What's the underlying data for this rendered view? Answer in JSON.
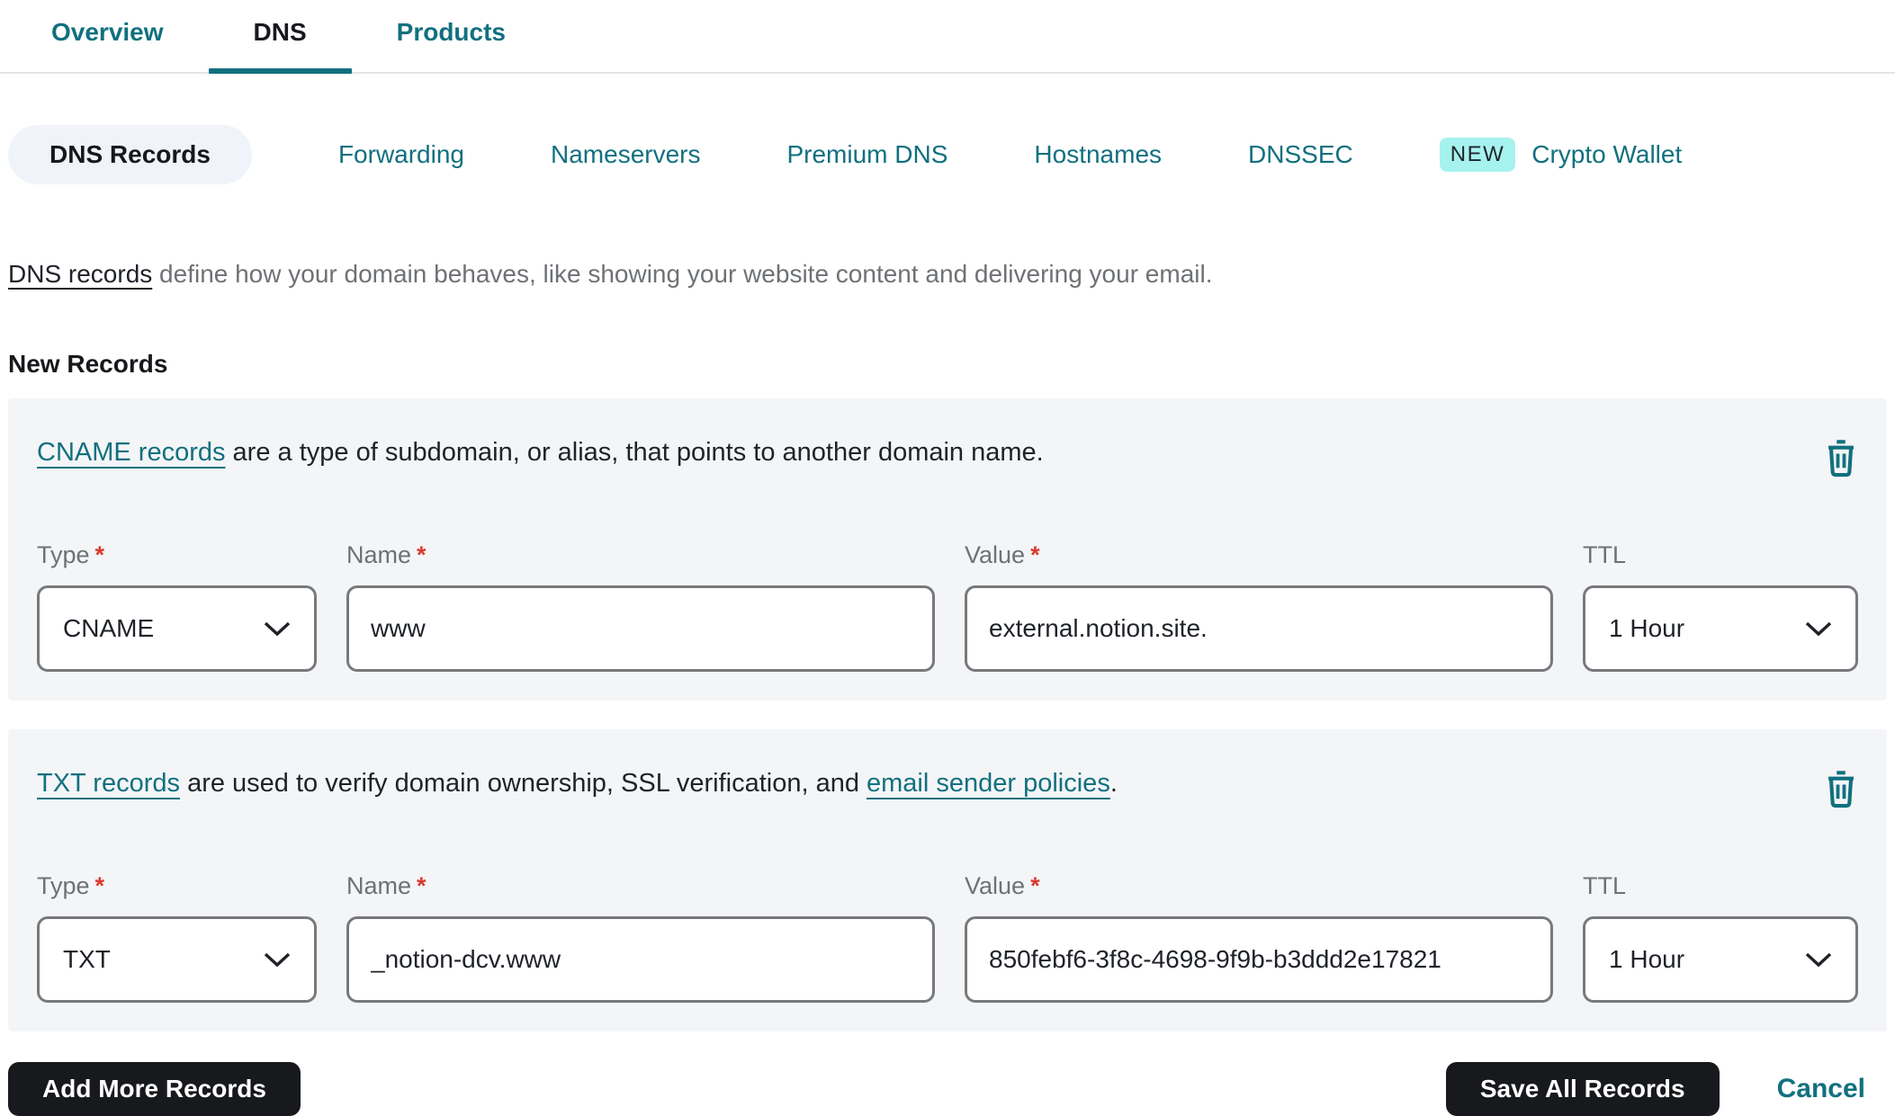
{
  "tabs": {
    "overview": "Overview",
    "dns": "DNS",
    "products": "Products"
  },
  "subtabs": {
    "dns_records": "DNS Records",
    "forwarding": "Forwarding",
    "nameservers": "Nameservers",
    "premium_dns": "Premium DNS",
    "hostnames": "Hostnames",
    "dnssec": "DNSSEC",
    "new_badge": "NEW",
    "crypto_wallet": "Crypto Wallet"
  },
  "intro": {
    "link": "DNS records",
    "text": " define how your domain behaves, like showing your website content and delivering your email."
  },
  "section_title": "New Records",
  "misc": {
    "required_mark": "*"
  },
  "records": [
    {
      "desc_link": "CNAME records",
      "desc_text": " are a type of subdomain, or alias, that points to another domain name.",
      "labels": {
        "type": "Type",
        "name": "Name",
        "value": "Value",
        "ttl": "TTL"
      },
      "type_value": "CNAME",
      "name_value": "www",
      "value_value": "external.notion.site.",
      "ttl_value": "1 Hour"
    },
    {
      "desc_link": "TXT records",
      "desc_text": " are used to verify domain ownership, SSL verification, and ",
      "desc_link2": "email sender policies",
      "desc_tail": ".",
      "labels": {
        "type": "Type",
        "name": "Name",
        "value": "Value",
        "ttl": "TTL"
      },
      "type_value": "TXT",
      "name_value": "_notion-dcv.www",
      "value_value": "850febf6-3f8c-4698-9f9b-b3ddd2e17821",
      "ttl_value": "1 Hour"
    }
  ],
  "actions": {
    "add_more": "Add More Records",
    "save_all": "Save All Records",
    "cancel": "Cancel"
  },
  "colors": {
    "teal": "#11707f",
    "badge_bg": "#a6f2ef",
    "card_bg": "#f4f5f7",
    "button_bg": "#17191c",
    "required_red": "#d93a2d"
  }
}
